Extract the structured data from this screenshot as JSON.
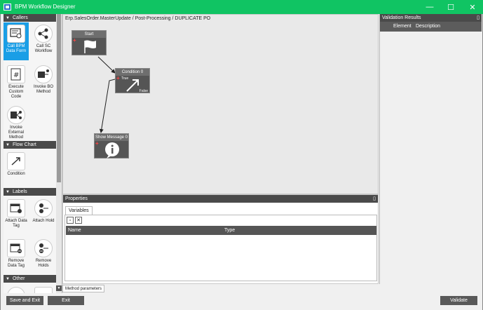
{
  "window": {
    "title": "BPM Workflow Designer",
    "minimize_glyph": "—",
    "maximize_glyph": "☐",
    "close_glyph": "✕"
  },
  "toolbox": {
    "sections": [
      {
        "label": "Callers",
        "tools": [
          "Call BPM Data Form",
          "Call SC Workflow",
          "Execute Custom Code",
          "Invoke BO Method",
          "Invoke External Method"
        ]
      },
      {
        "label": "Flow Chart",
        "tools": [
          "Condition"
        ]
      },
      {
        "label": "Labels",
        "tools": [
          "Attach Data Tag",
          "Attach Hold",
          "Remove Data Tag",
          "Remove Holds"
        ]
      },
      {
        "label": "Other",
        "tools": []
      }
    ],
    "selected_tool": "Call BPM Data Form"
  },
  "designer": {
    "breadcrumb": "Erp.SalesOrder.MasterUpdate / Post-Processing / DUPLICATE PO",
    "nodes": {
      "start": {
        "title": "Start"
      },
      "condition": {
        "title": "Condition 0",
        "true_label": "True",
        "false_label": "False"
      },
      "message": {
        "title": "Show Message 0"
      }
    }
  },
  "properties": {
    "title": "Properties",
    "tab": "Variables",
    "columns": [
      "Name",
      "Type"
    ]
  },
  "validation": {
    "title": "Validation Results",
    "columns": [
      "Element",
      "Description"
    ]
  },
  "bottom": {
    "method_parameters": "Method parameters",
    "save_and_exit": "Save and Exit",
    "exit": "Exit",
    "validate": "Validate"
  },
  "colors": {
    "titlebar": "#10c463",
    "accent": "#1a9ee6",
    "panel_header": "#4a4a4a"
  }
}
